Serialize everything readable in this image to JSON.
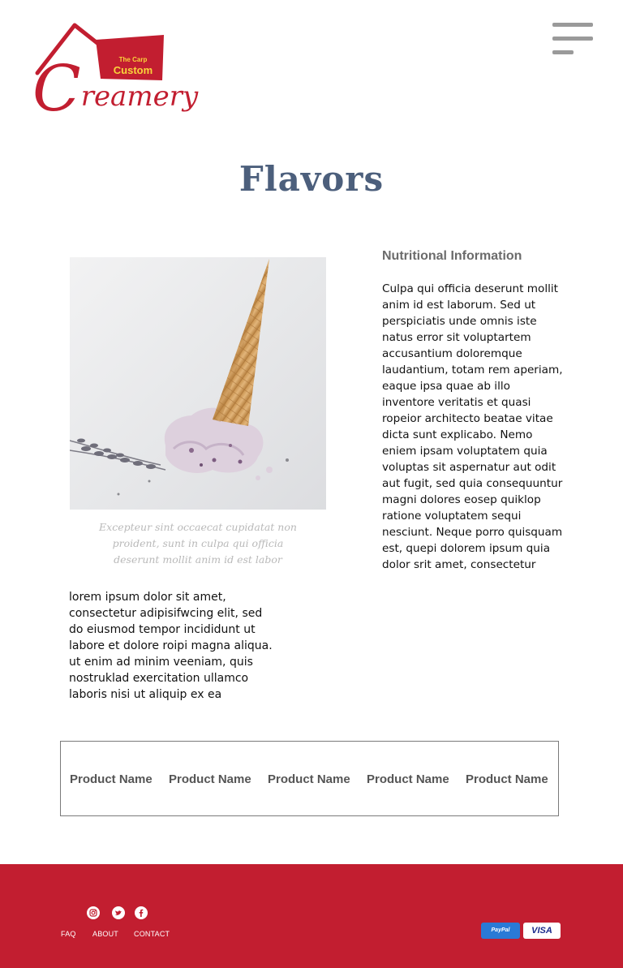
{
  "header": {
    "logo": {
      "tag_small": "The Carp",
      "tag_main": "Custom",
      "script_initial": "C",
      "script_rest": "reamery"
    },
    "menu_icon": "hamburger-menu-icon"
  },
  "page": {
    "title": "Flavors"
  },
  "product": {
    "image_subject": "ice-cream-cone-dropped",
    "caption": "Excepteur sint occaecat cupidatat non proident, sunt in culpa qui officia deserunt mollit anim id est labor",
    "description": "lorem ipsum dolor sit amet, consectetur adipisifwcing elit, sed do eiusmod tempor incididunt ut labore et dolore roipi magna aliqua. ut enim ad minim veeniam, quis nostruklad exercitation ullamco laboris nisi ut aliquip ex ea"
  },
  "nutrition": {
    "heading": "Nutritional Information",
    "text": "Culpa qui officia deserunt mollit anim id est laborum. Sed ut perspiciatis unde omnis iste natus error sit voluptartem accusantium doloremque laudantium, totam rem aperiam, eaque ipsa quae ab illo inventore veritatis et quasi ropeior architecto beatae vitae dicta sunt explicabo. Nemo eniem ipsam voluptatem quia voluptas sit aspernatur aut odit aut fugit, sed quia consequuntur magni dolores eosep quiklop ratione voluptatem sequi nesciunt. Neque porro quisquam est, quepi dolorem ipsum quia dolor srit amet, consectetur"
  },
  "products": {
    "items": [
      {
        "label": "Product Name"
      },
      {
        "label": "Product Name"
      },
      {
        "label": "Product Name"
      },
      {
        "label": "Product Name"
      },
      {
        "label": "Product Name"
      }
    ]
  },
  "footer": {
    "social": [
      "instagram-icon",
      "twitter-icon",
      "facebook-icon"
    ],
    "links": {
      "faq": "FAQ",
      "about": "ABOUT",
      "contact": "CONTACT"
    },
    "payments": {
      "paypal": "PayPal",
      "visa": "VISA"
    }
  },
  "colors": {
    "brand_red": "#c21e30",
    "title_slate": "#4c5f7c",
    "logo_yellow": "#f9d43b",
    "menu_gray": "#9a9a9a"
  }
}
